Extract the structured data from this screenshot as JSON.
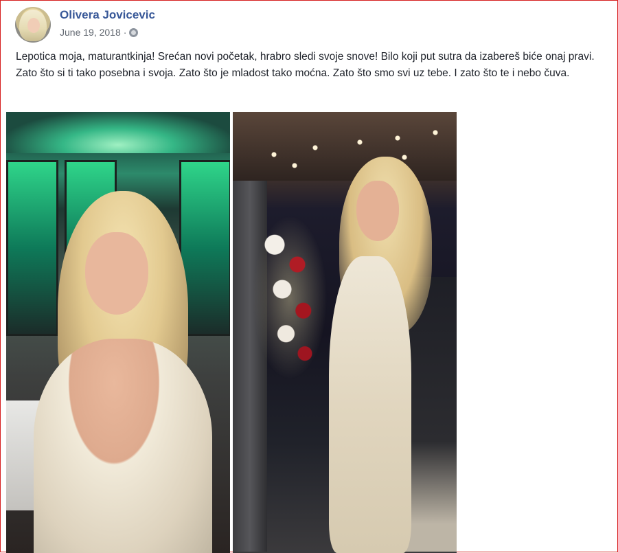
{
  "post": {
    "author": "Olivera Jovicevic",
    "date": "June 19, 2018",
    "date_separator": "·",
    "privacy_icon": "globe-icon",
    "text": "Lepotica moja, maturantkinja! Srećan novi početak, hrabro sledi svoje snove! Bilo koji put sutra da izabereš biće onaj pravi. Zato što si ti tako posebna i svoja. Zato što je mladost tako moćna. Zato što smo svi uz tebe. I zato što te i nebo čuva."
  },
  "colors": {
    "author_link": "#385898",
    "meta_text": "#616770",
    "body_text": "#1d2129",
    "frame_border": "#d61e1e"
  }
}
